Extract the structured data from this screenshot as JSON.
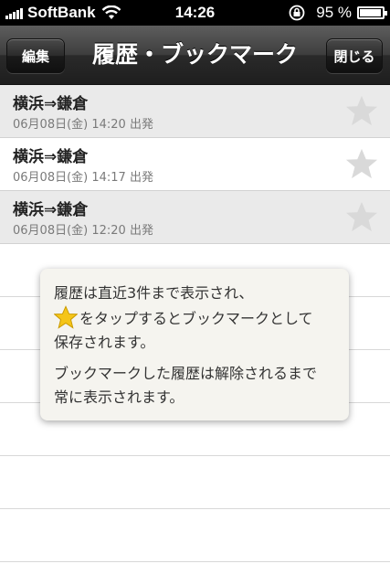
{
  "status_bar": {
    "carrier": "SoftBank",
    "time": "14:26",
    "battery_percent": "95 %",
    "battery_level": 0.95
  },
  "navbar": {
    "title": "履歴・ブックマーク",
    "edit_label": "編集",
    "close_label": "閉じる"
  },
  "history": [
    {
      "title": "横浜⇒鎌倉",
      "subtitle": "06月08日(金) 14:20 出発",
      "bookmarked": false
    },
    {
      "title": "横浜⇒鎌倉",
      "subtitle": "06月08日(金) 14:17 出発",
      "bookmarked": false
    },
    {
      "title": "横浜⇒鎌倉",
      "subtitle": "06月08日(金) 12:20 出発",
      "bookmarked": false
    }
  ],
  "help_popup": {
    "line1": "履歴は直近3件まで表示され、",
    "line2": "をタップするとブックマークとして",
    "line3": "保存されます。",
    "line4": "ブックマークした履歴は解除されるまで",
    "line5": "常に表示されます。"
  },
  "colors": {
    "star_inactive": "#d9d9d9",
    "star_active": "#f5c518"
  }
}
